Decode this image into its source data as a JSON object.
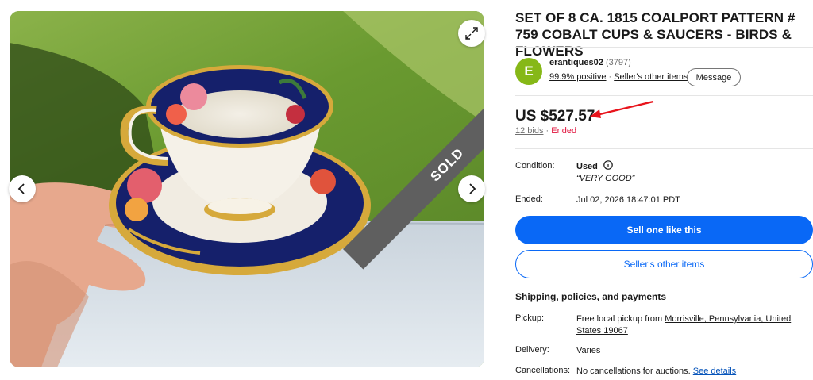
{
  "gallery": {
    "sold_label": "SOLD",
    "icons": {
      "prev": "chevron-left-icon",
      "next": "chevron-right-icon",
      "expand": "expand-icon"
    }
  },
  "listing": {
    "title": "SET OF 8 CA. 1815 COALPORT PATTERN # 759 COBALT CUPS & SAUCERS - BIRDS & FLOWERS"
  },
  "seller": {
    "avatar_letter": "E",
    "name": "erantiques02",
    "feedback_count": "(3797)",
    "positive": "99.9% positive",
    "separator": "·",
    "other_items_link": "Seller's other items",
    "message_button": "Message"
  },
  "price": {
    "amount": "US $527.57",
    "bids": "12 bids",
    "separator": "·",
    "status": "Ended"
  },
  "details": {
    "condition_label": "Condition:",
    "condition_value": "Used",
    "condition_desc": "“VERY GOOD”",
    "ended_label": "Ended:",
    "ended_value": "Jul 02, 2026 18:47:01 PDT"
  },
  "actions": {
    "sell_one": "Sell one like this",
    "sellers_other_items": "Seller's other items"
  },
  "shipping": {
    "heading": "Shipping, policies, and payments",
    "pickup_label": "Pickup:",
    "pickup_text": "Free local pickup from ",
    "pickup_location": "Morrisville, Pennsylvania, United States 19067",
    "delivery_label": "Delivery:",
    "delivery_value": "Varies",
    "cancellations_label": "Cancellations:",
    "cancellations_value": "No cancellations for auctions. ",
    "see_details": "See details"
  },
  "colors": {
    "primary_blue": "#0968f6",
    "avatar_green": "#86b817",
    "ended_red": "#e0103a",
    "annotation_arrow": "#e8141c"
  }
}
